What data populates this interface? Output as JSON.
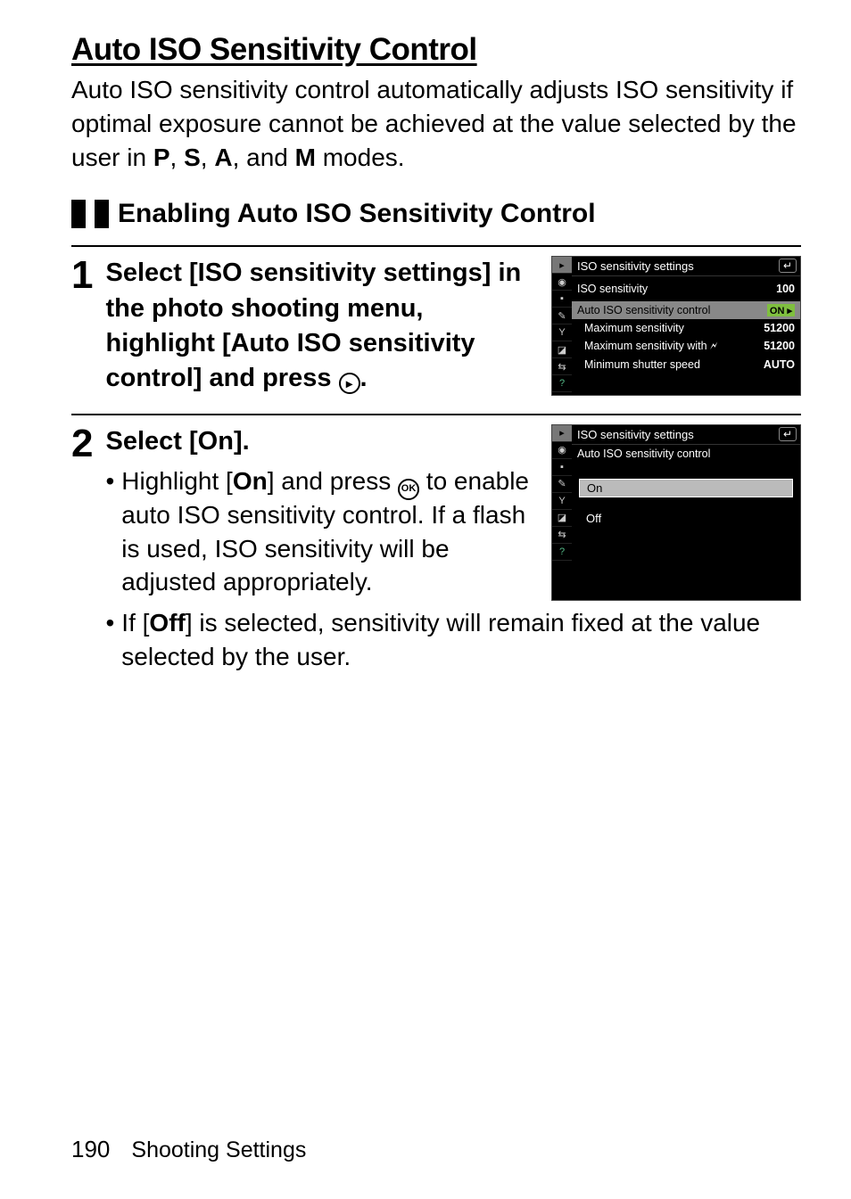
{
  "section_title": "Auto ISO Sensitivity Control",
  "intro_parts": {
    "a": "Auto ISO sensitivity control automatically adjusts ISO sensitivity if optimal exposure cannot be achieved at the value selected by the user in ",
    "p": "P",
    "c1": ", ",
    "s": "S",
    "c2": ", ",
    "amode": "A",
    "c3": ", and ",
    "m": "M",
    "tail": " modes."
  },
  "sub_title": "Enabling Auto ISO Sensitivity Control",
  "steps": {
    "s1": {
      "num": "1",
      "head_parts": {
        "a": "Select [",
        "b": "ISO sensitivity settings",
        "c": "] in the photo shooting menu, highlight [",
        "d": "Auto ISO sensitivity control",
        "e": "] and press ",
        "f": "."
      }
    },
    "s2": {
      "num": "2",
      "head_parts": {
        "a": "Select [",
        "b": "On",
        "c": "]."
      },
      "bullets": {
        "b1": {
          "a": "Highlight [",
          "b": "On",
          "c": "] and press ",
          "d": " to enable auto ISO sensitivity control. If a flash is used, ISO sensitivity will be adjusted appropriately."
        },
        "b2": {
          "a": "If [",
          "b": "Off",
          "c": "] is selected, sensitivity will remain fixed at the value selected by the user."
        }
      }
    }
  },
  "lcd1": {
    "title": "ISO sensitivity settings",
    "back": "↵",
    "rows": {
      "iso": {
        "label": "ISO sensitivity",
        "val": "100"
      },
      "auto": {
        "label": "Auto ISO sensitivity control",
        "val": "ON ▸"
      },
      "max": {
        "label": "Maximum sensitivity",
        "val": "51200"
      },
      "maxf": {
        "label": "Maximum sensitivity with 🗲",
        "val": "51200"
      },
      "min": {
        "label": "Minimum shutter speed",
        "val": "AUTO"
      }
    }
  },
  "lcd2": {
    "title": "ISO sensitivity settings",
    "sub": "Auto ISO sensitivity control",
    "back": "↵",
    "opts": {
      "on": "On",
      "off": "Off"
    }
  },
  "footer": {
    "page": "190",
    "chapter": "Shooting Settings"
  }
}
